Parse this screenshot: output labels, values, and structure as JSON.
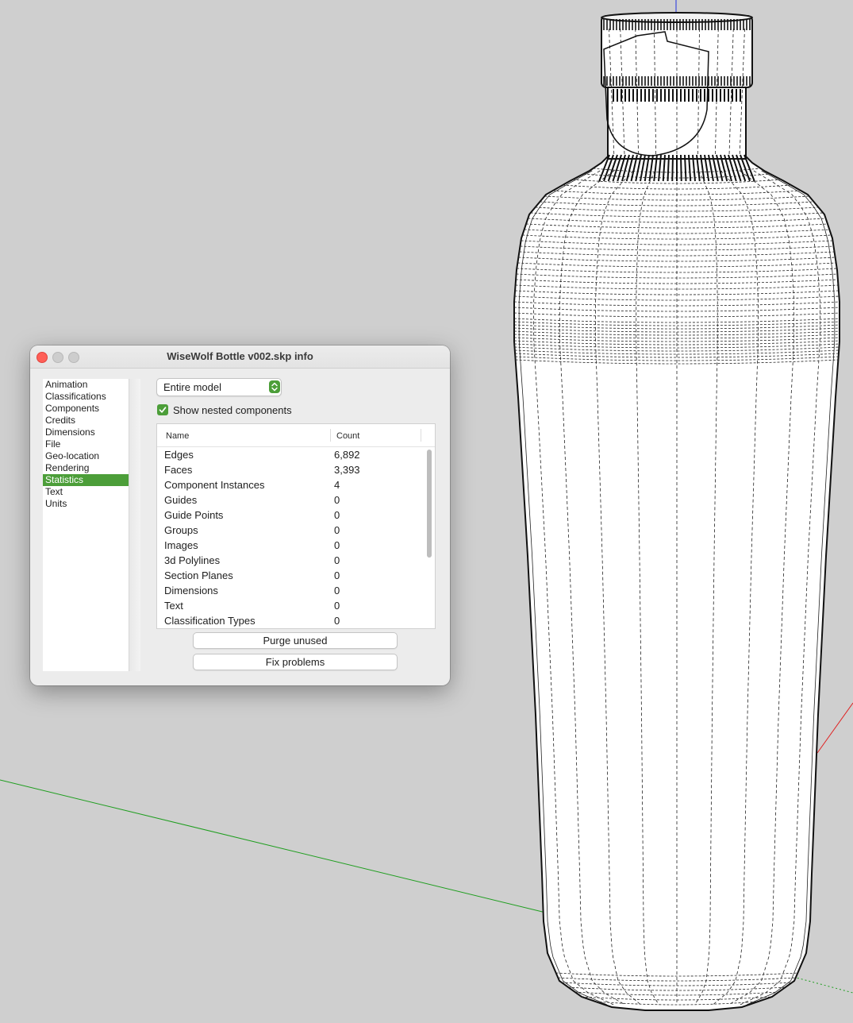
{
  "window": {
    "title": "WiseWolf Bottle v002.skp info"
  },
  "sidebar": {
    "items": [
      {
        "label": "Animation"
      },
      {
        "label": "Classifications"
      },
      {
        "label": "Components"
      },
      {
        "label": "Credits"
      },
      {
        "label": "Dimensions"
      },
      {
        "label": "File"
      },
      {
        "label": "Geo-location"
      },
      {
        "label": "Rendering"
      },
      {
        "label": "Statistics",
        "selected": true
      },
      {
        "label": "Text"
      },
      {
        "label": "Units"
      }
    ]
  },
  "statistics": {
    "scope_select": {
      "value": "Entire model"
    },
    "show_nested": {
      "label": "Show nested components",
      "checked": true
    },
    "columns": {
      "name": "Name",
      "count": "Count"
    },
    "rows": [
      {
        "name": "Edges",
        "count": "6,892"
      },
      {
        "name": "Faces",
        "count": "3,393"
      },
      {
        "name": "Component Instances",
        "count": "4"
      },
      {
        "name": "Guides",
        "count": "0"
      },
      {
        "name": "Guide Points",
        "count": "0"
      },
      {
        "name": "Groups",
        "count": "0"
      },
      {
        "name": "Images",
        "count": "0"
      },
      {
        "name": "3d Polylines",
        "count": "0"
      },
      {
        "name": "Section Planes",
        "count": "0"
      },
      {
        "name": "Dimensions",
        "count": "0"
      },
      {
        "name": "Text",
        "count": "0"
      },
      {
        "name": "Classification Types",
        "count": "0"
      }
    ],
    "purge_label": "Purge unused",
    "fix_label": "Fix problems"
  },
  "colors": {
    "accent": "#4c9e39",
    "viewport_bg": "#cfcfcf",
    "close_button": "#ff5f57",
    "green_axis": "#1f9e1f",
    "red_axis": "#e02020",
    "blue_axis": "#2030e0"
  }
}
